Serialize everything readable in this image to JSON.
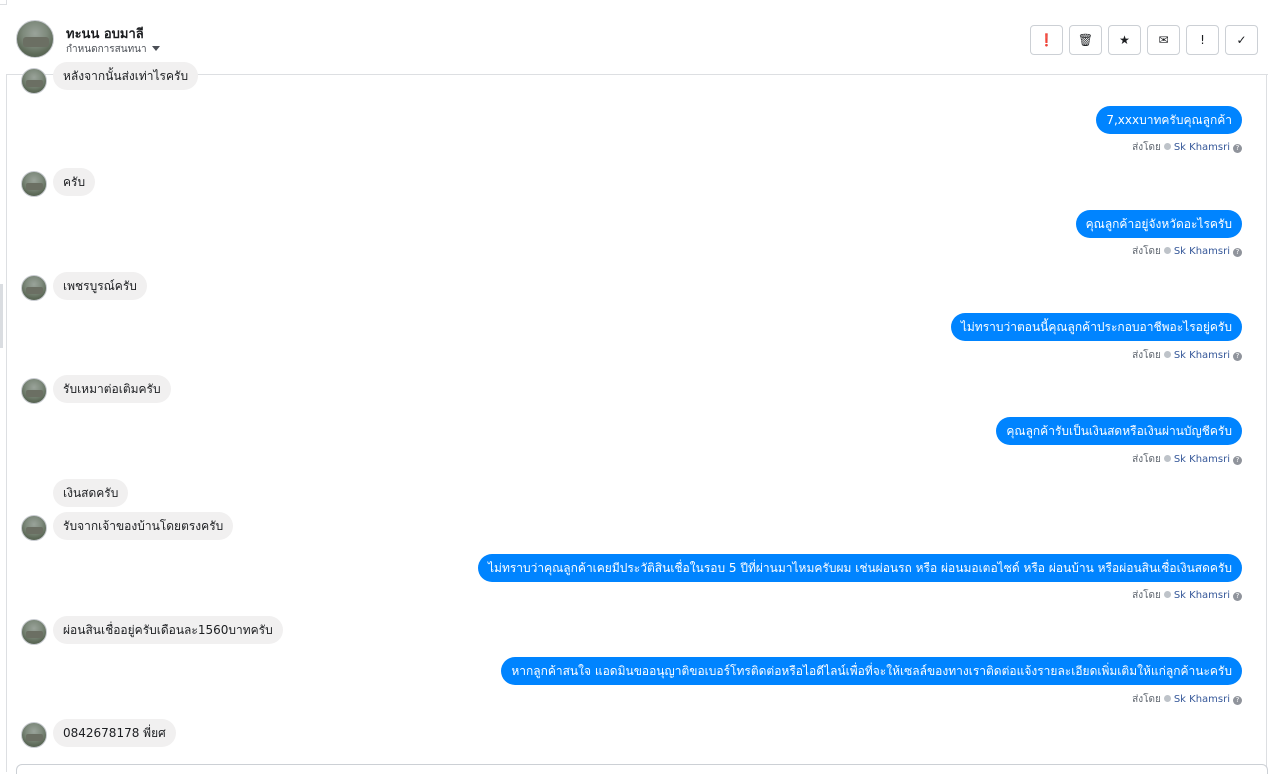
{
  "header": {
    "name": "ทะนน อบมาลี",
    "subtitle": "กำหนดการสนทนา",
    "actions": [
      {
        "icon": "alert-circle-icon",
        "glyph": "❗"
      },
      {
        "icon": "trash-icon",
        "glyph": "🗑"
      },
      {
        "icon": "star-icon",
        "glyph": "★"
      },
      {
        "icon": "envelope-icon",
        "glyph": "✉"
      },
      {
        "icon": "exclamation-icon",
        "glyph": "!"
      },
      {
        "icon": "check-icon",
        "glyph": "✓"
      }
    ]
  },
  "sent_by_label": "ส่งโดย",
  "agent_name": "Sk Khamsri",
  "messages": [
    {
      "dir": "in",
      "text": "หลังจากนั้นส่งเท่าไรครับ"
    },
    {
      "dir": "out",
      "text": "7,xxxบาทครับคุณลูกค้า"
    },
    {
      "dir": "in",
      "text": "ครับ"
    },
    {
      "dir": "out",
      "text": "คุณลูกค้าอยู่จังหวัดอะไรครับ"
    },
    {
      "dir": "in",
      "text": "เพชรบูรณ์ครับ"
    },
    {
      "dir": "out",
      "text": "ไม่ทราบว่าตอนนี้คุณลูกค้าประกอบอาชีพอะไรอยู่ครับ"
    },
    {
      "dir": "in",
      "text": "รับเหมาต่อเติมครับ"
    },
    {
      "dir": "out",
      "text": "คุณลูกค้ารับเป็นเงินสดหรือเงินผ่านบัญชีครับ"
    },
    {
      "dir": "in",
      "text": "เงินสดครับ"
    },
    {
      "dir": "in",
      "text": "รับจากเจ้าของบ้านโดยตรงครับ"
    },
    {
      "dir": "out",
      "text": "ไม่ทราบว่าคุณลูกค้าเคยมีประวัติสินเชื่อในรอบ 5 ปีที่ผ่านมาไหมครับผม เช่นผ่อนรถ หรือ ผ่อนมอเตอไซด์ หรือ ผ่อนบ้าน หรือผ่อนสินเชื่อเงินสดครับ"
    },
    {
      "dir": "in",
      "text": "ผ่อนสินเชื่ออยู่ครับเดือนละ1560บาทครับ"
    },
    {
      "dir": "out",
      "text": "หากลูกค้าสนใจ แอดมินขออนุญาติขอเบอร์โทรติดต่อหรือไอดีไลน์เพื่อที่จะให้เซลล์ของทางเราติดต่อแจ้งรายละเอียดเพิ่มเติมให้แก่ลูกค้านะครับ"
    },
    {
      "dir": "in",
      "text": "0842678178  พี่ยศ"
    }
  ]
}
